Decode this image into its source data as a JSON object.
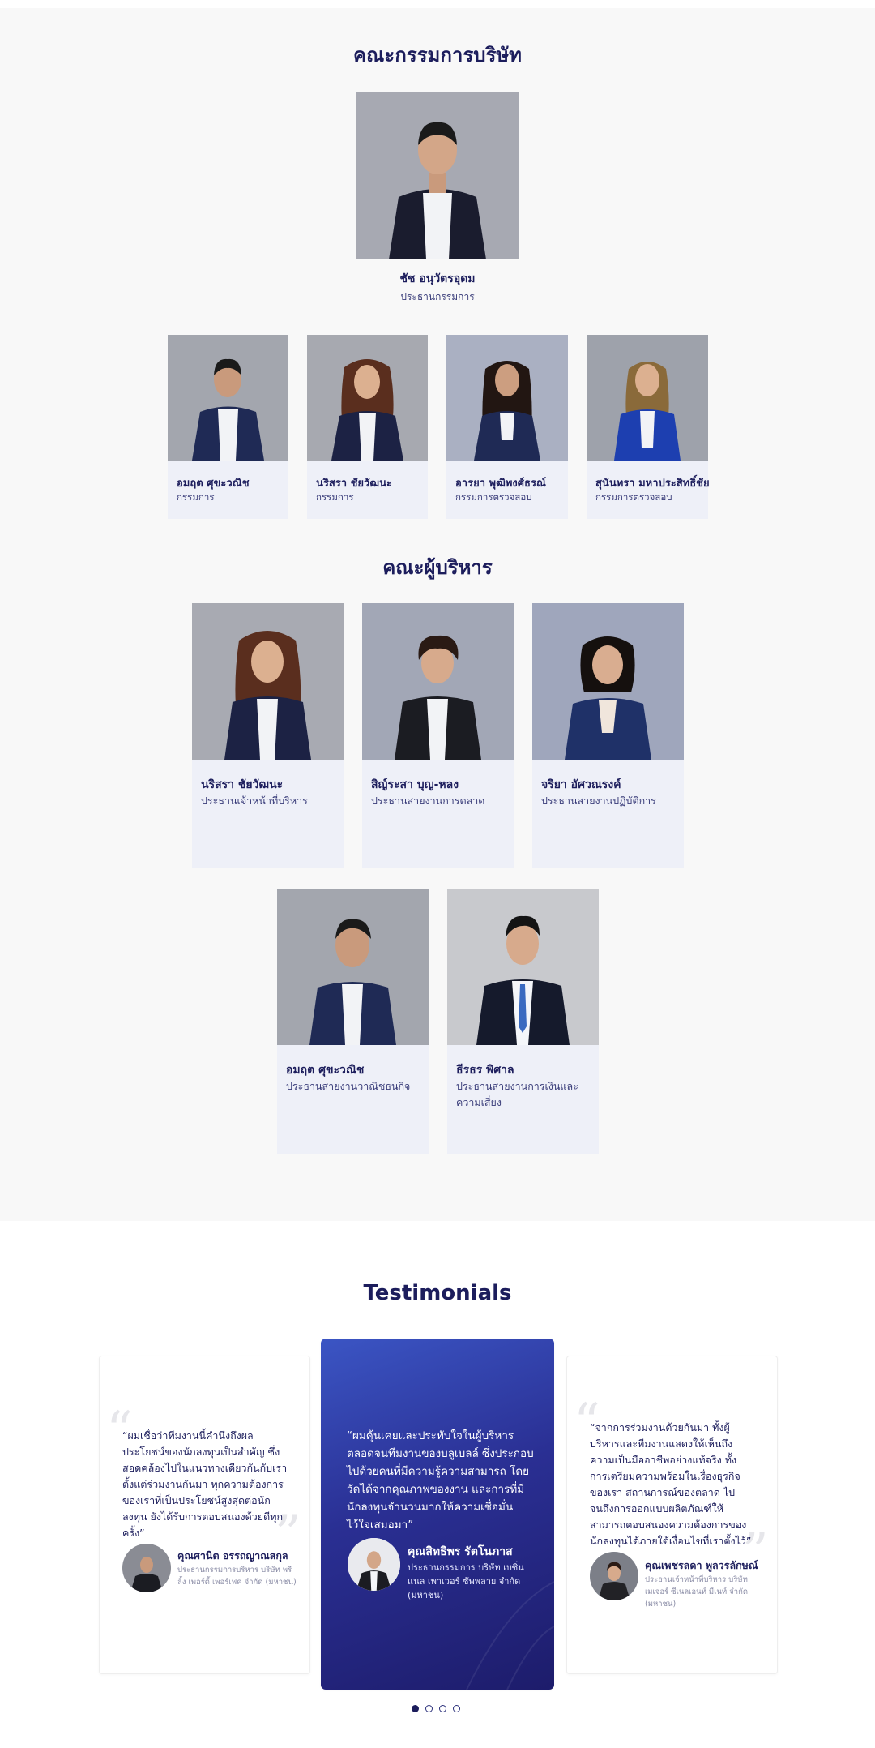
{
  "colors": {
    "primary": "#1c1d5c",
    "section_bg": "#f8f8f8",
    "card_bg": "#eef0f8",
    "active_card_gradient_start": "#3b55c4",
    "active_card_gradient_end": "#1d1c6b"
  },
  "board": {
    "heading": "คณะกรรมการบริษัท",
    "chairman": {
      "name": "ชัช อนุวัตรอุดม",
      "role": "ประธานกรรมการ"
    },
    "members": [
      {
        "name": "อมฤต ศุขะวณิช",
        "role": "กรรมการ"
      },
      {
        "name": "นริสรา ชัยวัฒนะ",
        "role": "กรรมการ"
      },
      {
        "name": "อารยา พุฒิพงศ์ธรณ์",
        "role": "กรรมการตรวจสอบ"
      },
      {
        "name": "สุนันทรา มหาประสิทธิ์ชัย",
        "role": "กรรมการตรวจสอบ"
      }
    ]
  },
  "executives": {
    "heading": "คณะผู้บริหาร",
    "members": [
      {
        "name": "นริสรา ชัยวัฒนะ",
        "role": "ประธานเจ้าหน้าที่บริหาร"
      },
      {
        "name": "สิญ์ระสา บุญ-หลง",
        "role": "ประธานสายงานการตลาด"
      },
      {
        "name": "จริยา อัศวณรงค์",
        "role": "ประธานสายงานปฏิบัติการ"
      },
      {
        "name": "อมฤต ศุขะวณิช",
        "role": "ประธานสายงานวาณิชธนกิจ"
      },
      {
        "name": "ธีรธร พิศาล",
        "role": "ประธานสายงานการเงินและความเสี่ยง"
      }
    ]
  },
  "testimonials": {
    "heading": "Testimonials",
    "items": [
      {
        "quote": "“ผมเชื่อว่าทีมงานนี้คำนึงถึงผลประโยชน์ของนักลงทุนเป็นสำคัญ ซึ่งสอดคล้องไปในแนวทางเดียวกันกับเรา ตั้งแต่ร่วมงานกันมา ทุกความต้องการของเราที่เป็นประโยชน์สูงสุดต่อนักลงทุน ยังได้รับการตอบสนองด้วยดีทุกครั้ง”",
        "name": "คุณศานิต อรรถญาณสกุล",
        "title": "ประธานกรรมการบริหาร บริษัท พรีลิ้ง เพอร์ดี้ เพอร์เฟค จำกัด (มหาชน)"
      },
      {
        "quote": "“ผมคุ้นเคยและประทับใจในผู้บริหารตลอดจนทีมงานของบลูเบลล์ ซึ่งประกอบไปด้วยคนที่มีความรู้ความสามารถ โดยวัดได้จากคุณภาพของงาน และการที่มีนักลงทุนจำนวนมากให้ความเชื่อมั่นไว้ใจเสมอมา”",
        "name": "คุณสิทธิพร รัตโนภาส",
        "title": "ประธานกรรมการ บริษัท เบซิ่นแนล เพาเวอร์ ซัพพลาย จำกัด (มหาชน)"
      },
      {
        "quote": "“จากการร่วมงานด้วยกันมา ทั้งผู้บริหารและทีมงานแสดงให้เห็นถึงความเป็นมืออาชีพอย่างแท้จริง ทั้งการเตรียมความพร้อมในเรื่องธุรกิจของเรา สถานการณ์ของตลาด ไปจนถึงการออกแบบผลิตภัณฑ์ให้สามารถตอบสนองความต้องการของนักลงทุนได้ภายใต้เงื่อนไขที่เราตั้งไว้”",
        "name": "คุณเพชรลดา พูลวรลักษณ์",
        "title": "ประธานเจ้าหน้าที่บริหาร บริษัท เมเจอร์ ซีเนลเอนท์ มีเนท์ จำกัด (มหาชน)"
      }
    ],
    "active_index": 1,
    "page_count": 4,
    "active_page": 1
  }
}
